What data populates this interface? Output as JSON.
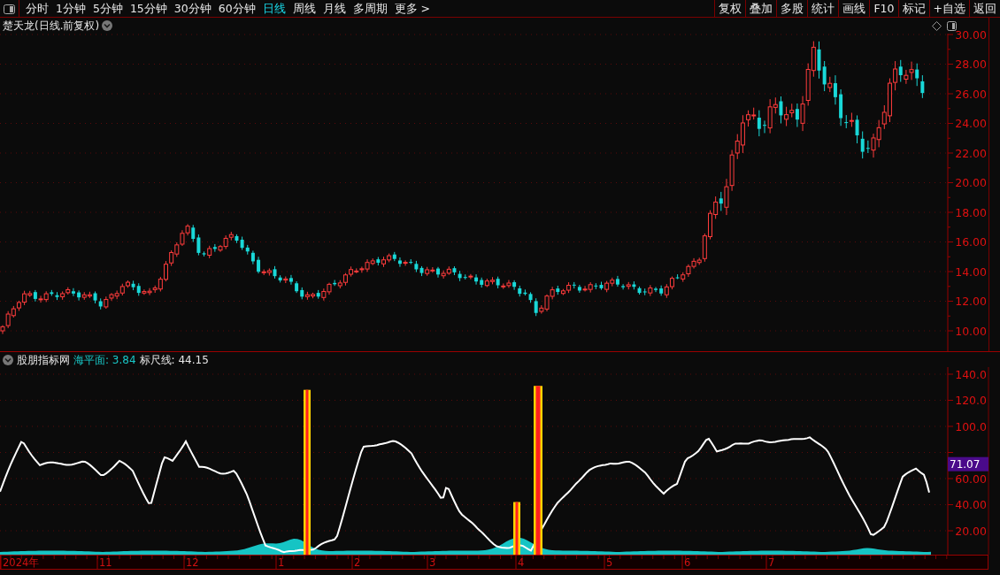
{
  "toolbar": {
    "periods": [
      {
        "label": "分时",
        "selected": false
      },
      {
        "label": "1分钟",
        "selected": false
      },
      {
        "label": "5分钟",
        "selected": false
      },
      {
        "label": "15分钟",
        "selected": false
      },
      {
        "label": "30分钟",
        "selected": false
      },
      {
        "label": "60分钟",
        "selected": false
      },
      {
        "label": "日线",
        "selected": true
      },
      {
        "label": "周线",
        "selected": false
      },
      {
        "label": "月线",
        "selected": false
      },
      {
        "label": "多周期",
        "selected": false
      },
      {
        "label": "更多 >",
        "selected": false
      }
    ],
    "buttons": [
      "复权",
      "叠加",
      "多股",
      "统计",
      "画线",
      "F10",
      "标记",
      "+自选",
      "返回"
    ]
  },
  "main_chart": {
    "title": "楚天龙(日线.前复权)",
    "price_axis": [
      "30.00",
      "28.00",
      "26.00",
      "24.00",
      "22.00",
      "20.00",
      "18.00",
      "16.00",
      "14.00",
      "12.00",
      "10.00"
    ]
  },
  "indicator": {
    "name": "股朋指标网",
    "values": [
      {
        "label": "海平面: 3.84",
        "color": "#19c8c8"
      },
      {
        "label": "标尺线: 44.15",
        "color": "#e8e8e8"
      }
    ],
    "axis": [
      "140.0",
      "120.0",
      "100.0",
      "60.00",
      "40.00",
      "20.00"
    ],
    "current_value": "71.07"
  },
  "time_axis": [
    "2024年",
    "11",
    "12",
    "1",
    "2",
    "3",
    "4",
    "5",
    "6",
    "7"
  ]
}
